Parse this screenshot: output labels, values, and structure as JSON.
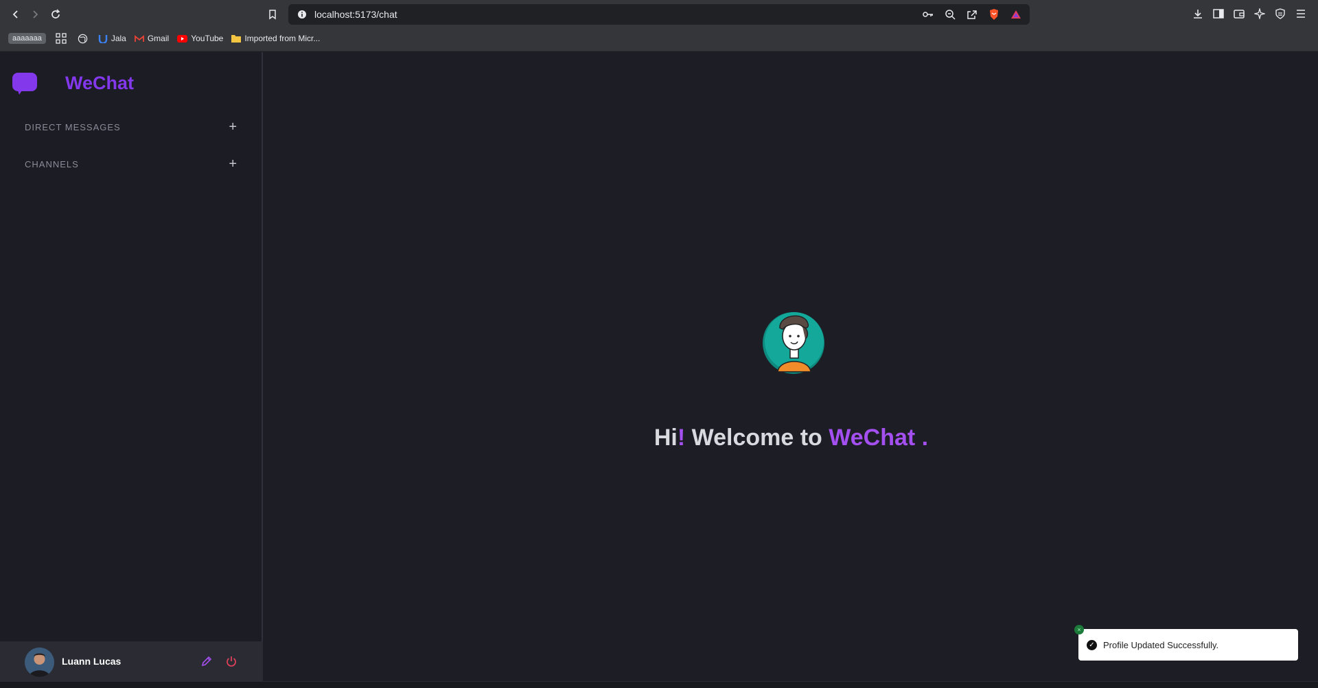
{
  "browser": {
    "url": "localhost:5173/chat",
    "profile_chip": "aaaaaaa",
    "bookmarks": [
      {
        "label": "Jala",
        "icon": "jala-icon"
      },
      {
        "label": "Gmail",
        "icon": "gmail-icon"
      },
      {
        "label": "YouTube",
        "icon": "youtube-icon"
      },
      {
        "label": "Imported from Micr...",
        "icon": "folder-icon"
      }
    ]
  },
  "sidebar": {
    "app_name": "WeChat",
    "sections": [
      {
        "label": "DIRECT MESSAGES",
        "action": "+"
      },
      {
        "label": "CHANNELS",
        "action": "+"
      }
    ],
    "user": {
      "name": "Luann Lucas"
    }
  },
  "main": {
    "welcome_hi": "Hi",
    "welcome_bang": "!",
    "welcome_mid": " Welcome to ",
    "welcome_brand": "WeChat",
    "welcome_dot": " ."
  },
  "toast": {
    "message": "Profile Updated Successfully.",
    "close": "×",
    "check": "✓"
  },
  "colors": {
    "accent": "#8338ec",
    "welcome_accent": "#a44ff0",
    "sidebar_bg": "#1b1c24",
    "main_bg": "#1c1d25",
    "power_icon": "#e0405a"
  }
}
